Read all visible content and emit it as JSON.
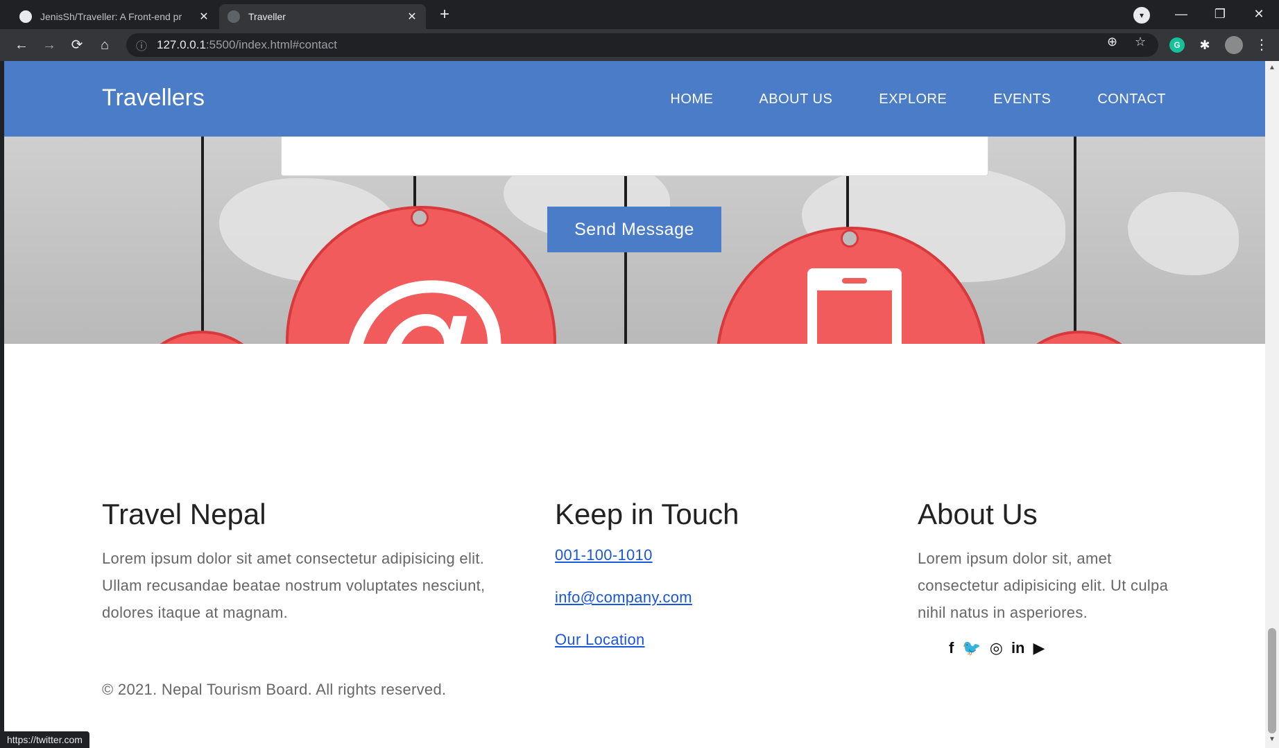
{
  "browser": {
    "tabs": [
      {
        "title": "JenisSh/Traveller: A Front-end pr",
        "close": "✕"
      },
      {
        "title": "Traveller",
        "close": "✕"
      }
    ],
    "new_tab": "+",
    "url_host": "127.0.0.1",
    "url_rest": ":5500/index.html#contact",
    "status_url": "https://twitter.com"
  },
  "site": {
    "brand": "Travellers",
    "nav": [
      "HOME",
      "ABOUT US",
      "EXPLORE",
      "EVENTS",
      "CONTACT"
    ],
    "accent_color": "#4a7cc7"
  },
  "contact": {
    "send_label": "Send Message"
  },
  "footer": {
    "col1": {
      "heading": "Travel Nepal",
      "text": "Lorem ipsum dolor sit amet consectetur adipisicing elit. Ullam recusandae beatae nostrum voluptates nesciunt, dolores itaque at magnam."
    },
    "col2": {
      "heading": "Keep in Touch",
      "phone": "001-100-1010",
      "email": "info@company.com",
      "location": "Our Location"
    },
    "col3": {
      "heading": "About Us",
      "text": "Lorem ipsum dolor sit, amet consectetur adipisicing elit. Ut culpa nihil natus in asperiores."
    },
    "social": [
      "facebook-icon",
      "twitter-icon",
      "instagram-icon",
      "linkedin-icon",
      "youtube-icon"
    ],
    "copyright": "© 2021. Nepal Tourism Board. All rights reserved."
  }
}
